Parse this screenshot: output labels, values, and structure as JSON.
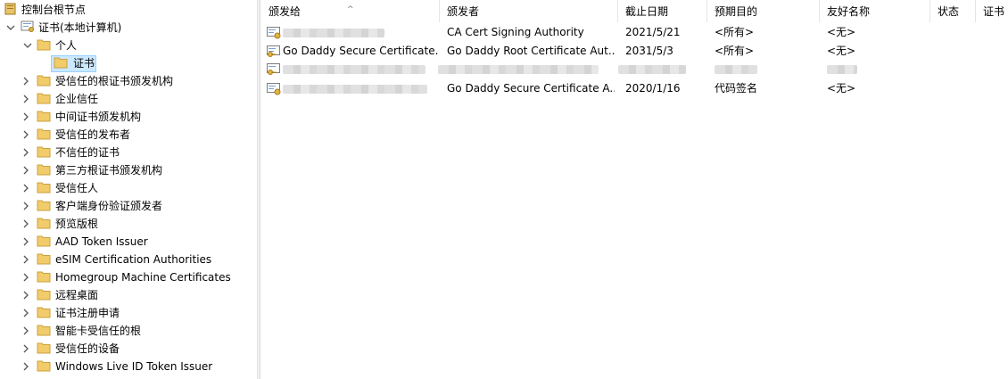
{
  "tree": {
    "root_label": "控制台根节点",
    "store_label": "证书(本地计算机)",
    "personal_label": "个人",
    "personal_child_label": "证书",
    "items": [
      "受信任的根证书颁发机构",
      "企业信任",
      "中间证书颁发机构",
      "受信任的发布者",
      "不信任的证书",
      "第三方根证书颁发机构",
      "受信任人",
      "客户端身份验证颁发者",
      "预览版根",
      "AAD Token Issuer",
      "eSIM Certification Authorities",
      "Homegroup Machine Certificates",
      "远程桌面",
      "证书注册申请",
      "智能卡受信任的根",
      "受信任的设备",
      "Windows Live ID Token Issuer"
    ]
  },
  "list": {
    "columns": [
      "颁发给",
      "颁发者",
      "截止日期",
      "预期目的",
      "友好名称",
      "状态",
      "证书"
    ],
    "rows": [
      {
        "issued_to": "",
        "issued_by": "CA Cert Signing Authority",
        "expiration": "2021/5/21",
        "purposes": "<所有>",
        "friendly": "<无>"
      },
      {
        "issued_to": "Go Daddy Secure Certificate...",
        "issued_by": "Go Daddy Root Certificate Aut...",
        "expiration": "2031/5/3",
        "purposes": "<所有>",
        "friendly": "<无>"
      },
      {
        "issued_to": "",
        "issued_by": "",
        "expiration": "",
        "purposes": "",
        "friendly": ""
      },
      {
        "issued_to": "",
        "issued_by": "Go Daddy Secure Certificate A...",
        "expiration": "2020/1/16",
        "purposes": "代码签名",
        "friendly": "<无>"
      }
    ]
  },
  "colors": {
    "selection_bg": "#cce8ff",
    "selection_border": "#99d1ff",
    "folder": "#f2cc6b"
  }
}
